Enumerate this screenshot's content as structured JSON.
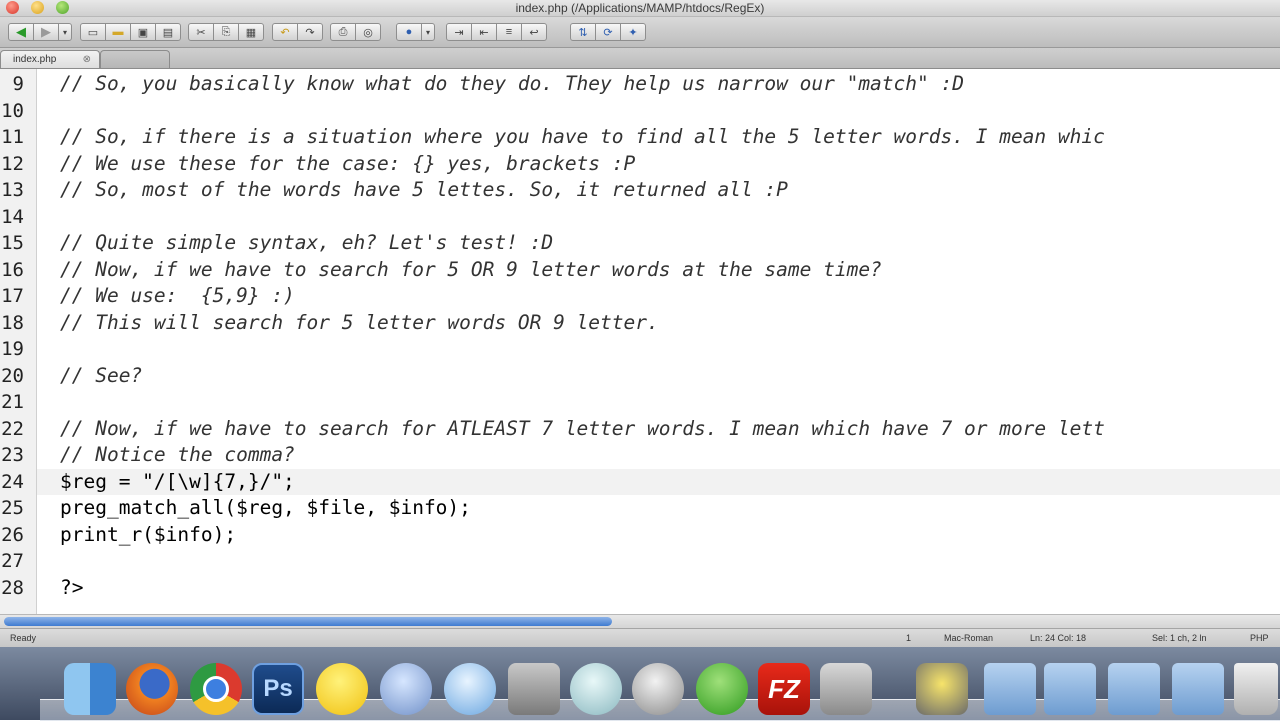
{
  "window": {
    "title": "index.php (/Applications/MAMP/htdocs/RegEx)"
  },
  "tabs": [
    {
      "label": "index.php",
      "close": "⊗",
      "active": true
    },
    {
      "label": "",
      "active": false
    }
  ],
  "editor": {
    "lines": [
      {
        "num": "9",
        "text": "// So, you basically know what do they do. They help us narrow our \"match\" :D",
        "kind": "comment"
      },
      {
        "num": "10",
        "text": "",
        "kind": "blank"
      },
      {
        "num": "11",
        "text": "// So, if there is a situation where you have to find all the 5 letter words. I mean whic",
        "kind": "comment"
      },
      {
        "num": "12",
        "text": "// We use these for the case: {} yes, brackets :P",
        "kind": "comment"
      },
      {
        "num": "13",
        "text": "// So, most of the words have 5 lettes. So, it returned all :P",
        "kind": "comment"
      },
      {
        "num": "14",
        "text": "",
        "kind": "blank"
      },
      {
        "num": "15",
        "text": "// Quite simple syntax, eh? Let's test! :D",
        "kind": "comment"
      },
      {
        "num": "16",
        "text": "// Now, if we have to search for 5 OR 9 letter words at the same time?",
        "kind": "comment"
      },
      {
        "num": "17",
        "text": "// We use:  {5,9} :)",
        "kind": "comment"
      },
      {
        "num": "18",
        "text": "// This will search for 5 letter words OR 9 letter.",
        "kind": "comment"
      },
      {
        "num": "19",
        "text": "",
        "kind": "blank"
      },
      {
        "num": "20",
        "text": "// See?",
        "kind": "comment"
      },
      {
        "num": "21",
        "text": "",
        "kind": "blank"
      },
      {
        "num": "22",
        "text": "// Now, if we have to search for ATLEAST 7 letter words. I mean which have 7 or more lett",
        "kind": "comment"
      },
      {
        "num": "23",
        "text": "// Notice the comma?",
        "kind": "comment"
      },
      {
        "num": "24",
        "text": "$reg = \"/[\\w]{7,}/\";",
        "kind": "code"
      },
      {
        "num": "25",
        "text": "preg_match_all($reg, $file, $info);",
        "kind": "code"
      },
      {
        "num": "26",
        "text": "print_r($info);",
        "kind": "code"
      },
      {
        "num": "27",
        "text": "",
        "kind": "blank"
      },
      {
        "num": "28",
        "text": "?>",
        "kind": "code"
      }
    ],
    "current_line": "24"
  },
  "statusbar": {
    "ready": "Ready",
    "item1": "1",
    "encoding": "Mac-Roman",
    "position": "Ln: 24 Col: 18",
    "selection": "Sel: 1 ch, 2 ln",
    "lang": "PHP"
  },
  "dock": {
    "apps": [
      {
        "name": "finder-icon",
        "label": ""
      },
      {
        "name": "firefox-icon",
        "label": ""
      },
      {
        "name": "chrome-icon",
        "label": ""
      },
      {
        "name": "photoshop-icon",
        "label": "Ps"
      },
      {
        "name": "messenger-icon",
        "label": ""
      },
      {
        "name": "facetime-icon",
        "label": ""
      },
      {
        "name": "itunes-icon",
        "label": ""
      },
      {
        "name": "system-preferences-icon",
        "label": ""
      },
      {
        "name": "growl-icon",
        "label": ""
      },
      {
        "name": "safari-icon",
        "label": ""
      },
      {
        "name": "utorrent-icon",
        "label": ""
      },
      {
        "name": "filezilla-icon",
        "label": "FZ"
      },
      {
        "name": "photo-booth-icon",
        "label": ""
      },
      {
        "name": "imovie-icon",
        "label": ""
      },
      {
        "name": "folder-icon",
        "label": ""
      },
      {
        "name": "folder-icon",
        "label": ""
      },
      {
        "name": "folder-icon",
        "label": ""
      },
      {
        "name": "folder-icon",
        "label": ""
      },
      {
        "name": "trash-icon",
        "label": ""
      }
    ],
    "colors": {
      "accent": "#3f7bd0"
    }
  }
}
